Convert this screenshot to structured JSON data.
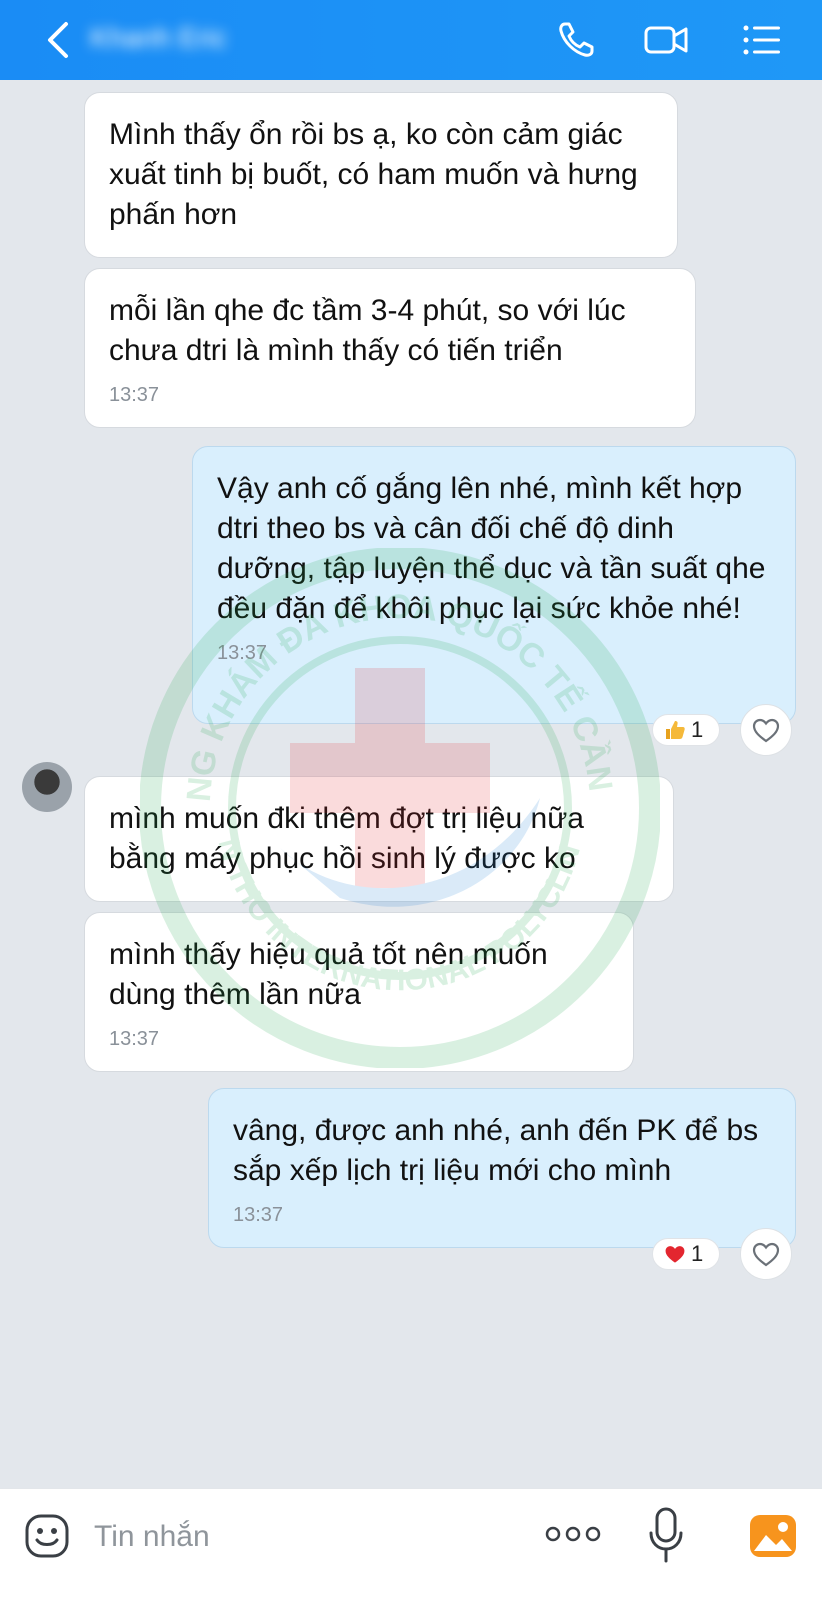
{
  "header": {
    "contact_name": "Khanh Eric",
    "icons": [
      "back-icon",
      "call-icon",
      "video-call-icon",
      "menu-icon"
    ]
  },
  "colors": {
    "header_bg": "#1a8cf5",
    "chat_bg": "#e3e7ec",
    "incoming_bubble": "#ffffff",
    "outgoing_bubble": "#d9effd",
    "accent": "#1f98f7"
  },
  "messages": [
    {
      "dir": "in",
      "text": "Mình thấy ổn rồi bs ạ, ko còn cảm giác xuất tinh bị buốt, có ham muốn và hưng phấn hơn",
      "time": ""
    },
    {
      "dir": "in",
      "text": "mỗi lần qhe đc tầm 3-4 phút, so với lúc chưa dtri là mình thấy có tiến triển",
      "time": "13:37"
    },
    {
      "dir": "out",
      "text": "Vậy anh cố gắng lên nhé, mình kết hợp dtri theo bs và cân đối chế độ dinh dưỡng, tập luyện thể dục và tần suất qhe đều đặn để khôi phục lại sức khỏe nhé!",
      "time": "13:37",
      "reaction": {
        "icon": "thumbs-up-icon",
        "count": "1"
      }
    },
    {
      "dir": "in",
      "text": "mình muốn đki thêm đợt trị liệu nữa bằng máy phục hồi sinh lý được ko",
      "time": ""
    },
    {
      "dir": "in",
      "text": "mình thấy hiệu quả tốt nên muốn dùng thêm lần nữa",
      "time": "13:37"
    },
    {
      "dir": "out",
      "text": "vâng, được anh nhé, anh đến PK để bs sắp xếp lịch trị liệu mới cho mình",
      "time": "13:37",
      "reaction": {
        "icon": "heart-icon",
        "count": "1"
      }
    }
  ],
  "watermark": {
    "top_text": "PHÒNG KHÁM ĐA KHOA QUỐC TẾ CẦN THƠ",
    "bottom_text": "CAN THO INTERNATIONAL POLYCLINICS"
  },
  "input_bar": {
    "placeholder": "Tin nhắn",
    "icons": [
      "sticker-icon",
      "more-icon",
      "microphone-icon",
      "photo-icon"
    ]
  }
}
